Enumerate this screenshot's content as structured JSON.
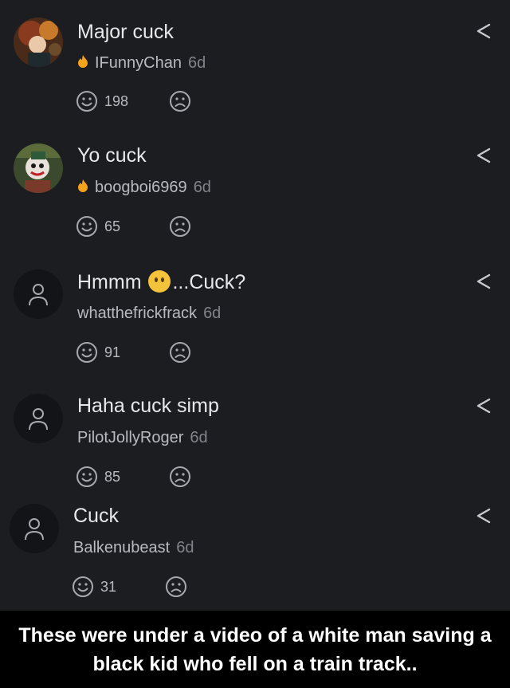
{
  "comments": [
    {
      "text": "Major cuck",
      "username": "IFunnyChan",
      "time": "6d",
      "likes": "198",
      "has_flame": true,
      "avatar": "photo-woman"
    },
    {
      "text": "Yo cuck",
      "username": "boogboi6969",
      "time": "6d",
      "likes": "65",
      "has_flame": true,
      "avatar": "photo-joker"
    },
    {
      "text_before": "Hmmm ",
      "emoji": "thinking-face",
      "text_after": "...Cuck?",
      "username": "whatthefrickfrack",
      "time": "6d",
      "likes": "91",
      "has_flame": false,
      "avatar": "default-user"
    },
    {
      "text": "Haha cuck simp",
      "username": "PilotJollyRoger",
      "time": "6d",
      "likes": "85",
      "has_flame": false,
      "avatar": "default-user"
    },
    {
      "text": "Cuck",
      "username": "Balkenubeast",
      "time": "6d",
      "likes": "31",
      "has_flame": false,
      "avatar": "default-user"
    }
  ],
  "caption": "These were under a video of a white man saving a black kid who fell on a train track..",
  "colors": {
    "background": "#1c1d21",
    "flame": "#f6a31c",
    "caption_bg": "#000000"
  }
}
